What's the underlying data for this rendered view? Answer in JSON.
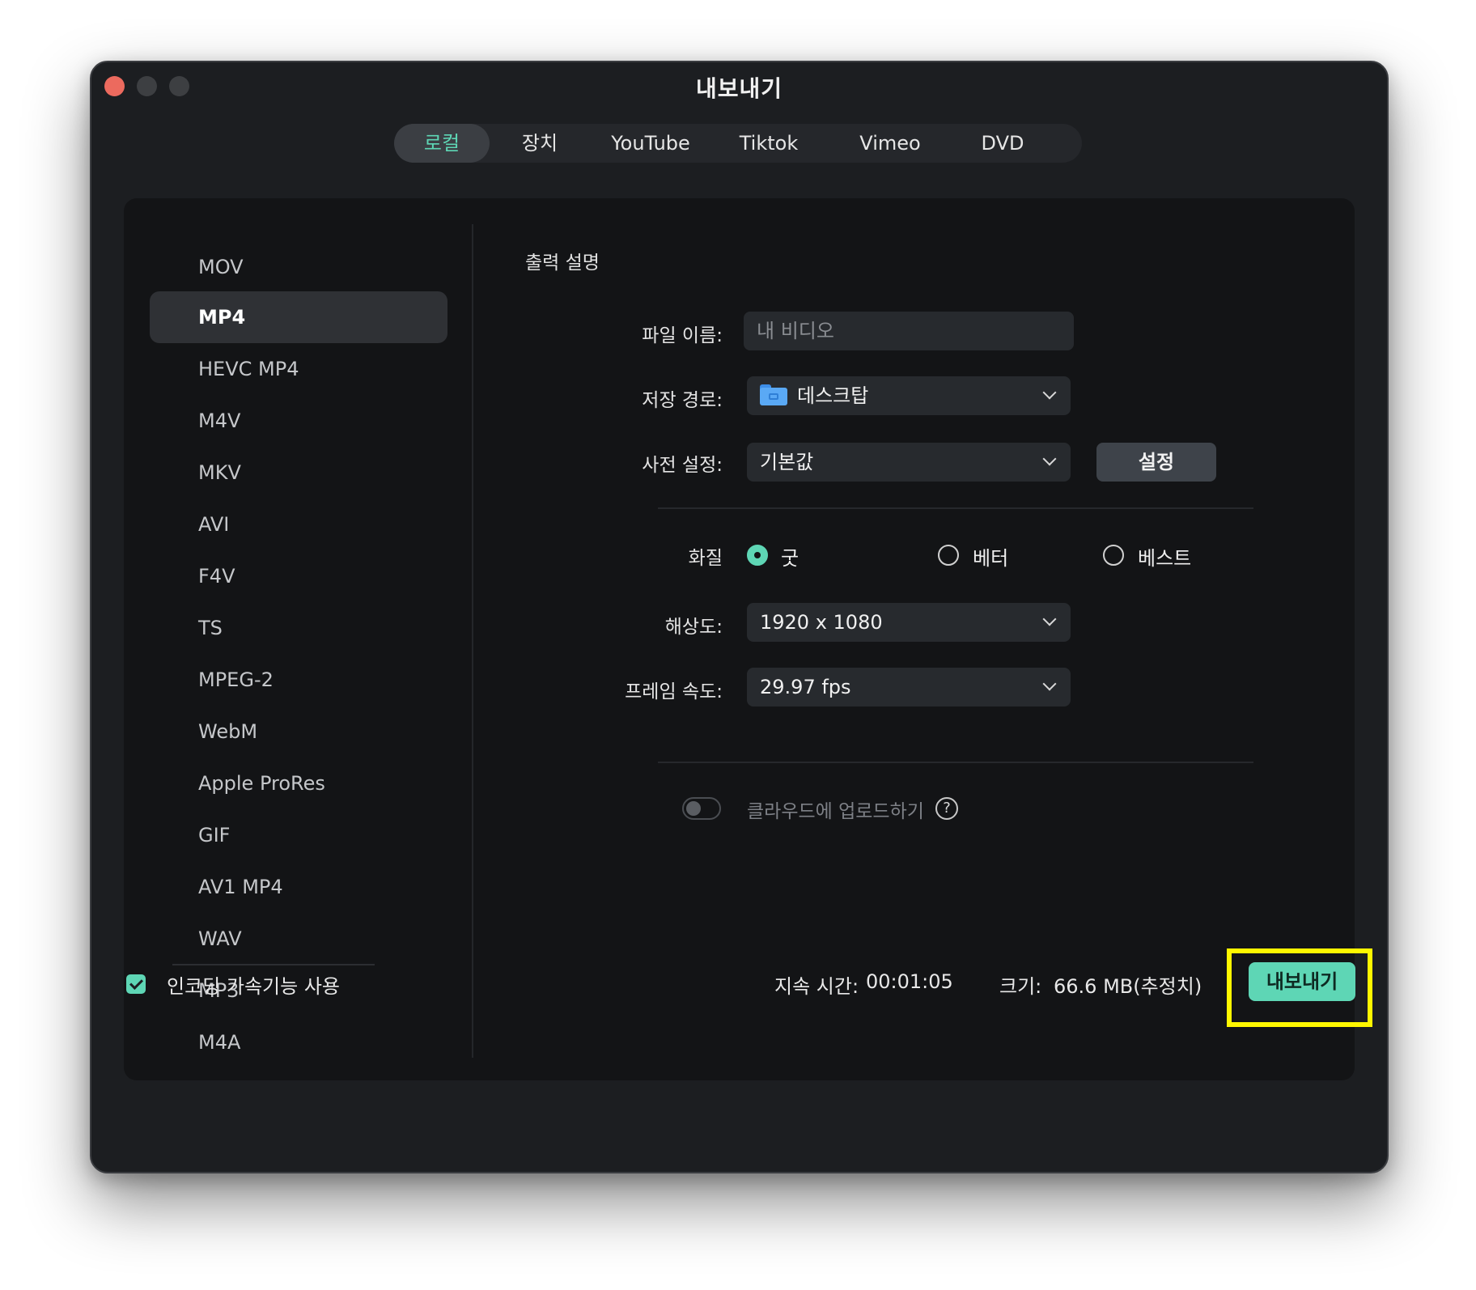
{
  "window": {
    "title": "내보내기"
  },
  "tabs": [
    {
      "label": "로컬",
      "active": true
    },
    {
      "label": "장치"
    },
    {
      "label": "YouTube"
    },
    {
      "label": "Tiktok"
    },
    {
      "label": "Vimeo"
    },
    {
      "label": "DVD"
    }
  ],
  "formats": [
    "MOV",
    "MP4",
    "HEVC MP4",
    "M4V",
    "MKV",
    "AVI",
    "F4V",
    "TS",
    "MPEG-2",
    "WebM",
    "Apple ProRes",
    "GIF",
    "AV1 MP4",
    "WAV",
    "MP3",
    "M4A"
  ],
  "selected_format": "MP4",
  "settings": {
    "section_title": "출력 설명",
    "filename_label": "파일 이름:",
    "filename_placeholder": "내 비디오",
    "save_path_label": "저장 경로:",
    "save_path_value": "데스크탑",
    "save_path_icon": "folder-icon",
    "preset_label": "사전 설정:",
    "preset_value": "기본값",
    "settings_button": "설정",
    "quality_label": "화질",
    "quality_options": [
      "굿",
      "베터",
      "베스트"
    ],
    "quality_selected": "굿",
    "resolution_label": "해상도:",
    "resolution_value": "1920 x 1080",
    "framerate_label": "프레임 속도:",
    "framerate_value": "29.97 fps",
    "cloud_upload_label": "클라우드에 업로드하기",
    "cloud_upload_enabled": false,
    "help_icon": "?"
  },
  "footer": {
    "hw_accel_label": "인코딩 가속기능 사용",
    "hw_accel_checked": true,
    "duration_label": "지속 시간:",
    "duration_value": "00:01:05",
    "size_label": "크기:",
    "size_value": "66.6 MB(추정치)",
    "export_button": "내보내기"
  },
  "colors": {
    "accent": "#5ed6b5",
    "window_bg": "#1c1e21",
    "panel_bg": "#131416",
    "highlight_frame": "#fff700",
    "close_button": "#ec6a5e"
  }
}
